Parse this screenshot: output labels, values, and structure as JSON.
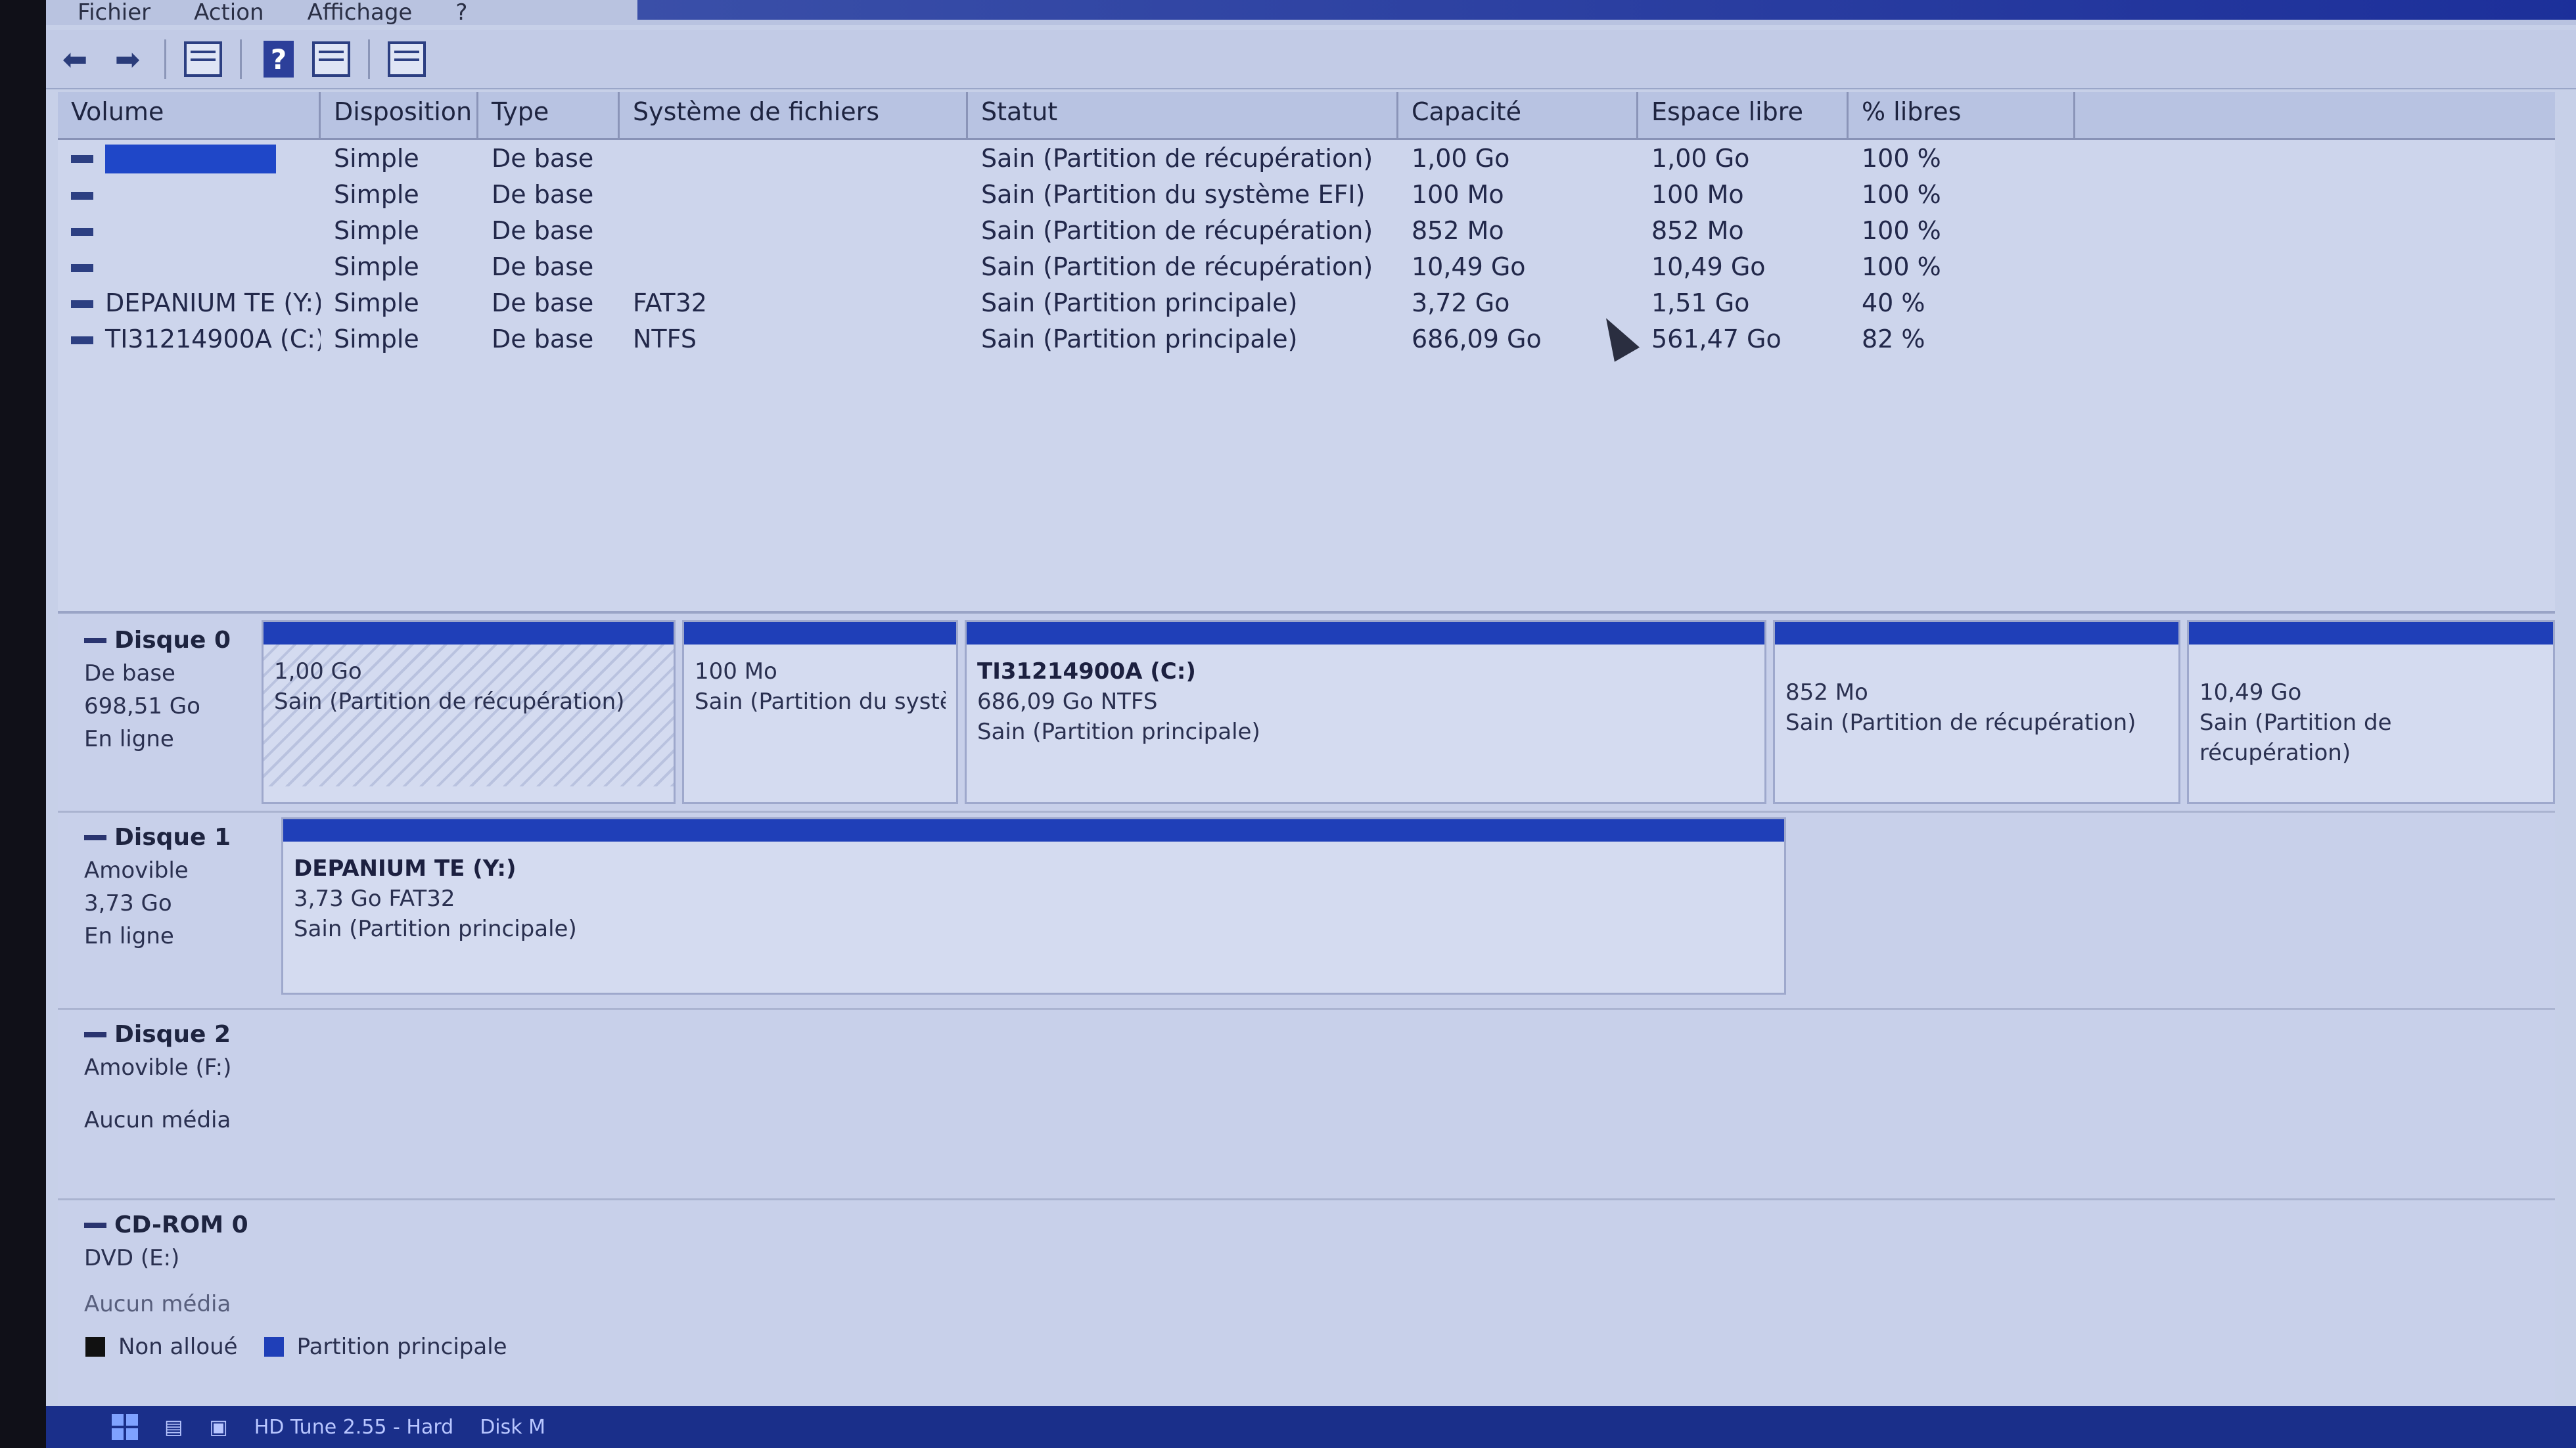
{
  "menu": {
    "items": [
      "Fichier",
      "Action",
      "Affichage",
      "?"
    ]
  },
  "volumes": {
    "columns": [
      "Volume",
      "Disposition",
      "Type",
      "Système de fichiers",
      "Statut",
      "Capacité",
      "Espace libre",
      "% libres"
    ],
    "rows": [
      {
        "volume": "",
        "disposition": "Simple",
        "type": "De base",
        "fs": "",
        "statut": "Sain (Partition de récupération)",
        "capacite": "1,00 Go",
        "libre": "1,00 Go",
        "pct": "100 %"
      },
      {
        "volume": "",
        "disposition": "Simple",
        "type": "De base",
        "fs": "",
        "statut": "Sain (Partition du système EFI)",
        "capacite": "100 Mo",
        "libre": "100 Mo",
        "pct": "100 %"
      },
      {
        "volume": "",
        "disposition": "Simple",
        "type": "De base",
        "fs": "",
        "statut": "Sain (Partition de récupération)",
        "capacite": "852 Mo",
        "libre": "852 Mo",
        "pct": "100 %"
      },
      {
        "volume": "",
        "disposition": "Simple",
        "type": "De base",
        "fs": "",
        "statut": "Sain (Partition de récupération)",
        "capacite": "10,49 Go",
        "libre": "10,49 Go",
        "pct": "100 %"
      },
      {
        "volume": "DEPANIUM TE (Y:)",
        "disposition": "Simple",
        "type": "De base",
        "fs": "FAT32",
        "statut": "Sain (Partition principale)",
        "capacite": "3,72 Go",
        "libre": "1,51 Go",
        "pct": "40 %"
      },
      {
        "volume": "TI31214900A (C:)",
        "disposition": "Simple",
        "type": "De base",
        "fs": "NTFS",
        "statut": "Sain (Partition principale)",
        "capacite": "686,09 Go",
        "libre": "561,47 Go",
        "pct": "82 %"
      }
    ]
  },
  "disks": {
    "disk0": {
      "name": "Disque 0",
      "type": "De base",
      "size": "698,51 Go",
      "status": "En ligne"
    },
    "disk0_parts": [
      {
        "name": "",
        "size": "1,00 Go",
        "status": "Sain (Partition de récupération)"
      },
      {
        "name": "",
        "size": "100 Mo",
        "status": "Sain (Partition du systè"
      },
      {
        "name": "TI31214900A (C:)",
        "size": "686,09 Go NTFS",
        "status": "Sain (Partition principale)"
      },
      {
        "name": "",
        "size": "852 Mo",
        "status": "Sain (Partition de récupération)"
      },
      {
        "name": "",
        "size": "10,49 Go",
        "status": "Sain (Partition de récupération)"
      }
    ],
    "disk1": {
      "name": "Disque 1",
      "type": "Amovible",
      "size": "3,73 Go",
      "status": "En ligne"
    },
    "disk1_part": {
      "name": "DEPANIUM TE (Y:)",
      "size": "3,73 Go FAT32",
      "status": "Sain (Partition principale)"
    },
    "disk2": {
      "name": "Disque 2",
      "type": "Amovible (F:)",
      "status": "Aucun média"
    },
    "cdrom": {
      "name": "CD-ROM 0",
      "type": "DVD (E:)",
      "status": "Aucun média"
    }
  },
  "legend": {
    "unallocated": "Non alloué",
    "primary": "Partition principale"
  },
  "taskbar": {
    "app1": "HD Tune 2.55 - Hard",
    "app2": "Disk M"
  },
  "colors": {
    "primary_partition": "#1f3fb8",
    "selection": "#1f47c8",
    "unallocated": "#111111"
  }
}
